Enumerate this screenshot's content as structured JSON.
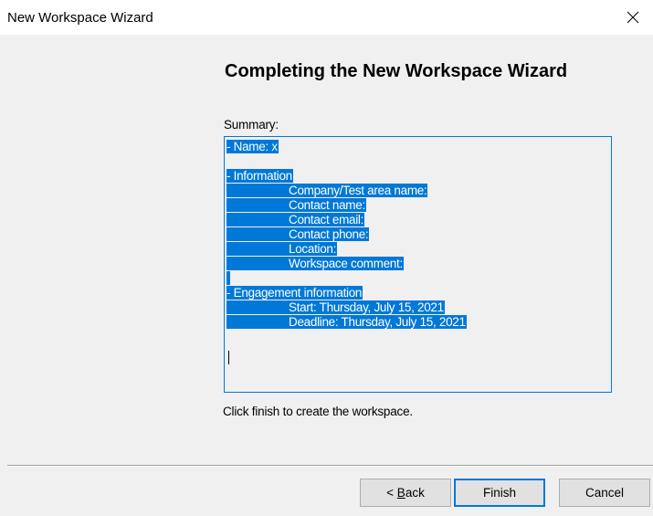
{
  "window": {
    "title": "New Workspace Wizard",
    "close_icon": "close-icon"
  },
  "page": {
    "heading": "Completing the New Workspace Wizard",
    "summary_label": "Summary:",
    "summary_lines": {
      "name": "- Name: x",
      "information": "- Information",
      "company": "Company/Test area name:",
      "contact_name": "Contact name:",
      "contact_email": "Contact email:",
      "contact_phone": "Contact phone:",
      "location": "Location:",
      "workspace_comment": "Workspace comment:",
      "engagement": "- Engagement information",
      "start": "Start: Thursday, July 15, 2021",
      "deadline": "Deadline: Thursday, July 15, 2021"
    },
    "instruction": "Click finish to create the workspace."
  },
  "buttons": {
    "back_prefix": "< ",
    "back_mnemonic": "B",
    "back_rest": "ack",
    "finish": "Finish",
    "cancel": "Cancel"
  },
  "colors": {
    "selection": "#0078d7",
    "focus_border": "#0078d7",
    "button_bg": "#e1e1e1",
    "window_bg": "#f0f0f0"
  }
}
